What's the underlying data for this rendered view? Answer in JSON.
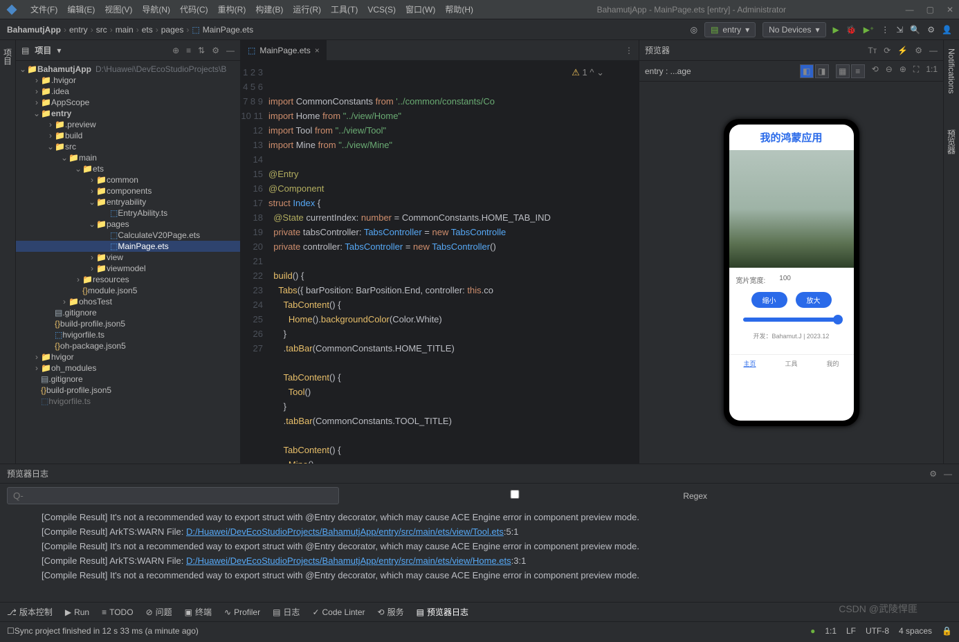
{
  "window_title": "BahamutjApp - MainPage.ets [entry] - Administrator",
  "menus": [
    "文件(F)",
    "编辑(E)",
    "视图(V)",
    "导航(N)",
    "代码(C)",
    "重构(R)",
    "构建(B)",
    "运行(R)",
    "工具(T)",
    "VCS(S)",
    "窗口(W)",
    "帮助(H)"
  ],
  "breadcrumb": [
    "BahamutjApp",
    "entry",
    "src",
    "main",
    "ets",
    "pages",
    "MainPage.ets"
  ],
  "run_config": "entry",
  "device": "No Devices",
  "project_label": "项目",
  "left_tab": "项目",
  "right_tab_top": "Notifications",
  "right_tab_bottom": "预览器",
  "tree": {
    "root": "BahamutjApp",
    "root_hint": "D:\\Huawei\\DevEcoStudioProjects\\B",
    "nodes": [
      ".hvigor",
      ".idea",
      "AppScope"
    ],
    "entry": "entry",
    "entry_children": [
      ".preview",
      "build"
    ],
    "src": "src",
    "main": "main",
    "ets": "ets",
    "ets_children": [
      "common",
      "components"
    ],
    "entryability": "entryability",
    "entryability_file": "EntryAbility.ts",
    "pages": "pages",
    "pages_files": [
      "CalculateV20Page.ets",
      "MainPage.ets"
    ],
    "other_ets": [
      "view",
      "viewmodel"
    ],
    "resources": "resources",
    "module": "module.json5",
    "ohostest": "ohosTest",
    "root_files": [
      ".gitignore",
      "build-profile.json5",
      "hvigorfile.ts",
      "oh-package.json5"
    ],
    "hvigor2": "hvigor",
    "oh_modules": "oh_modules",
    "foot_files": [
      ".gitignore",
      "build-profile.json5",
      "hvigorfile.ts"
    ]
  },
  "editor": {
    "tab": "MainPage.ets",
    "line_count": 27
  },
  "preview": {
    "title": "预览器",
    "subtitle": "entry : ...age",
    "app_title": "我的鸿蒙应用",
    "width_label": "宽片宽度:",
    "width_value": "100",
    "btn1": "缩小",
    "btn2": "放大",
    "dev": "开发：Bahamut.J | 2023.12",
    "tabs": [
      "主页",
      "工具",
      "我的"
    ]
  },
  "log_panel": {
    "title": "预览器日志",
    "search_placeholder": "Q-",
    "regex_label": "Regex",
    "lines": [
      {
        "text": "[Compile Result]  It's not a recommended way to export struct with @Entry decorator, which may cause ACE Engine error in component preview mode."
      },
      {
        "prefix": "[Compile Result] ArkTS:WARN File: ",
        "link": "D:/Huawei/DevEcoStudioProjects/BahamutjApp/entry/src/main/ets/view/Tool.ets",
        "suffix": ":5:1"
      },
      {
        "text": "[Compile Result]  It's not a recommended way to export struct with @Entry decorator, which may cause ACE Engine error in component preview mode."
      },
      {
        "prefix": "[Compile Result] ArkTS:WARN File: ",
        "link": "D:/Huawei/DevEcoStudioProjects/BahamutjApp/entry/src/main/ets/view/Home.ets",
        "suffix": ":3:1"
      },
      {
        "text": "[Compile Result]  It's not a recommended way to export struct with @Entry decorator, which may cause ACE Engine error in component preview mode."
      }
    ]
  },
  "bottom_tabs": [
    "版本控制",
    "Run",
    "TODO",
    "问题",
    "终端",
    "Profiler",
    "日志",
    "Code Linter",
    "服务",
    "预览器日志"
  ],
  "status": {
    "msg": "Sync project finished in 12 s 33 ms (a minute ago)",
    "pos": "1:1",
    "lf": "LF",
    "enc": "UTF-8",
    "indent": "4 spaces"
  },
  "watermark": "CSDN @武陵悍匪"
}
